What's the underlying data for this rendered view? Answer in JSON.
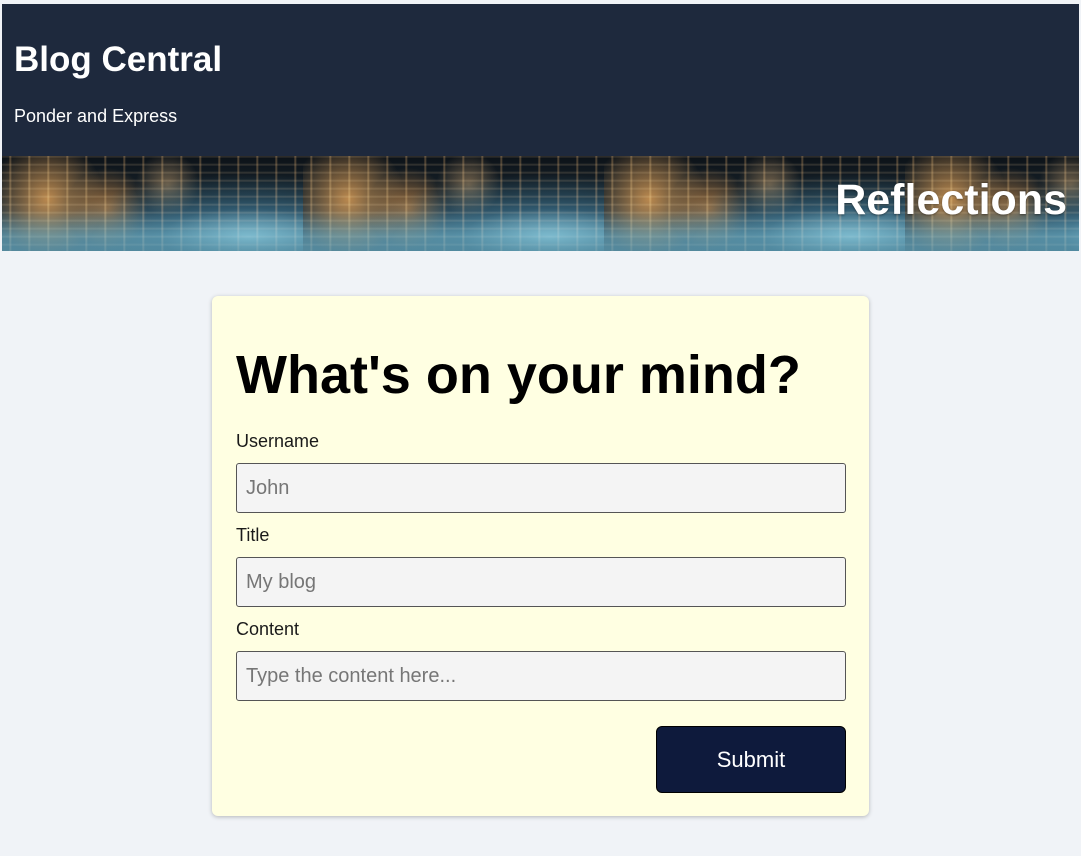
{
  "header": {
    "title": "Blog Central",
    "tagline": "Ponder and Express",
    "background": "#1e293d"
  },
  "banner": {
    "text": "Reflections",
    "image": "city-lights-bokeh"
  },
  "form": {
    "heading": "What's on your mind?",
    "username": {
      "label": "Username",
      "placeholder": "John",
      "value": ""
    },
    "title": {
      "label": "Title",
      "placeholder": "My blog",
      "value": ""
    },
    "content": {
      "label": "Content",
      "placeholder": "Type the content here...",
      "value": ""
    },
    "submit_label": "Submit",
    "card_background": "#ffffe2",
    "submit_background": "#0e1a3c"
  },
  "page_background": "#f0f3f7"
}
